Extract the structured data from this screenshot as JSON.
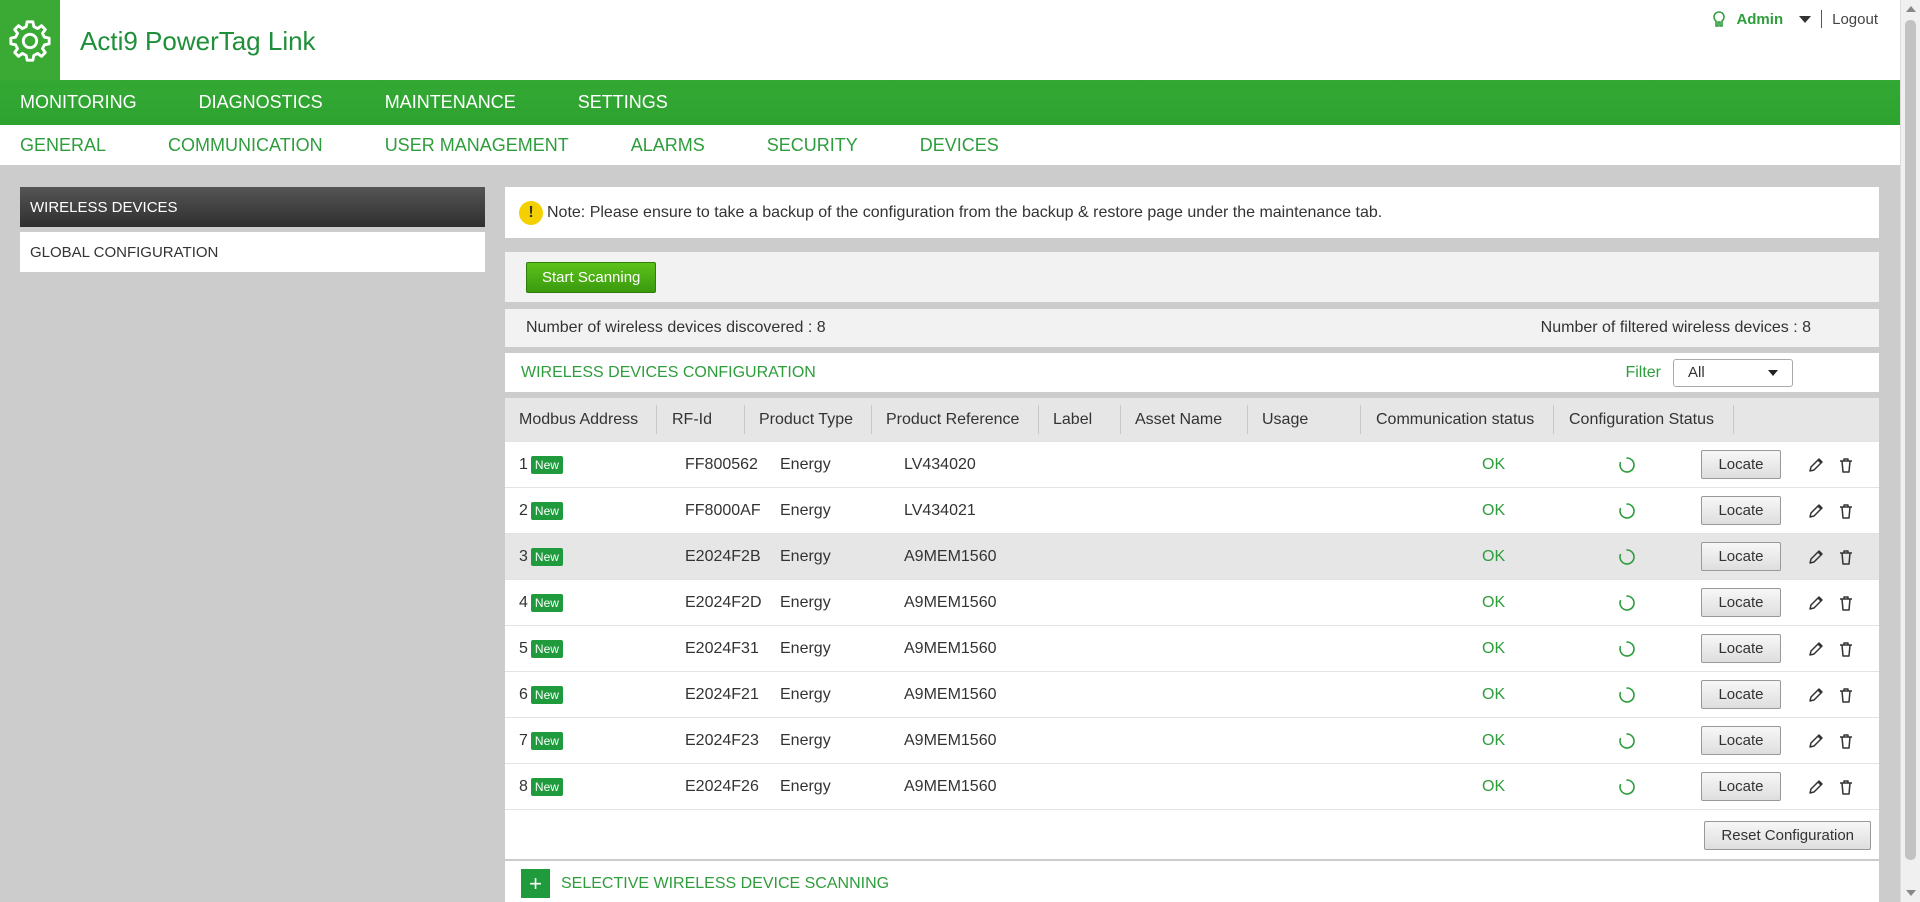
{
  "header": {
    "app_title": "Acti9 PowerTag Link",
    "user_name": "Admin",
    "logout_label": "Logout",
    "brand_color": "#3aaa35"
  },
  "primary_nav": [
    {
      "label": "MONITORING"
    },
    {
      "label": "DIAGNOSTICS"
    },
    {
      "label": "MAINTENANCE"
    },
    {
      "label": "SETTINGS"
    }
  ],
  "secondary_nav": [
    {
      "label": "GENERAL"
    },
    {
      "label": "COMMUNICATION"
    },
    {
      "label": "USER MANAGEMENT"
    },
    {
      "label": "ALARMS"
    },
    {
      "label": "SECURITY"
    },
    {
      "label": "DEVICES"
    }
  ],
  "sidebar": {
    "items": [
      {
        "label": "WIRELESS DEVICES",
        "active": true
      },
      {
        "label": "GLOBAL CONFIGURATION",
        "active": false
      }
    ]
  },
  "note": {
    "icon": "!",
    "text": "Note: Please ensure to take a backup of the configuration from the backup & restore page under the maintenance tab."
  },
  "scan": {
    "button_label": "Start Scanning"
  },
  "counts": {
    "discovered": "Number of wireless devices discovered : 8",
    "filtered": "Number of filtered wireless devices : 8"
  },
  "config": {
    "title": "WIRELESS DEVICES CONFIGURATION",
    "filter_label": "Filter",
    "filter_value": "All"
  },
  "table": {
    "columns": [
      "Modbus Address",
      "RF-Id",
      "Product Type",
      "Product Reference",
      "Label",
      "Asset Name",
      "Usage",
      "Communication status",
      "Configuration Status"
    ],
    "badge_label": "New",
    "locate_label": "Locate",
    "rows": [
      {
        "addr": "1",
        "rfid": "FF800562",
        "type": "Energy",
        "ref": "LV434020",
        "label": "",
        "asset": "",
        "usage": "",
        "comm": "OK"
      },
      {
        "addr": "2",
        "rfid": "FF8000AF",
        "type": "Energy",
        "ref": "LV434021",
        "label": "",
        "asset": "",
        "usage": "",
        "comm": "OK"
      },
      {
        "addr": "3",
        "rfid": "E2024F2B",
        "type": "Energy",
        "ref": "A9MEM1560",
        "label": "",
        "asset": "",
        "usage": "",
        "comm": "OK"
      },
      {
        "addr": "4",
        "rfid": "E2024F2D",
        "type": "Energy",
        "ref": "A9MEM1560",
        "label": "",
        "asset": "",
        "usage": "",
        "comm": "OK"
      },
      {
        "addr": "5",
        "rfid": "E2024F31",
        "type": "Energy",
        "ref": "A9MEM1560",
        "label": "",
        "asset": "",
        "usage": "",
        "comm": "OK"
      },
      {
        "addr": "6",
        "rfid": "E2024F21",
        "type": "Energy",
        "ref": "A9MEM1560",
        "label": "",
        "asset": "",
        "usage": "",
        "comm": "OK"
      },
      {
        "addr": "7",
        "rfid": "E2024F23",
        "type": "Energy",
        "ref": "A9MEM1560",
        "label": "",
        "asset": "",
        "usage": "",
        "comm": "OK"
      },
      {
        "addr": "8",
        "rfid": "E2024F26",
        "type": "Energy",
        "ref": "A9MEM1560",
        "label": "",
        "asset": "",
        "usage": "",
        "comm": "OK"
      }
    ]
  },
  "reset_label": "Reset Configuration",
  "selective": {
    "icon": "+",
    "title": "SELECTIVE WIRELESS DEVICE SCANNING"
  }
}
